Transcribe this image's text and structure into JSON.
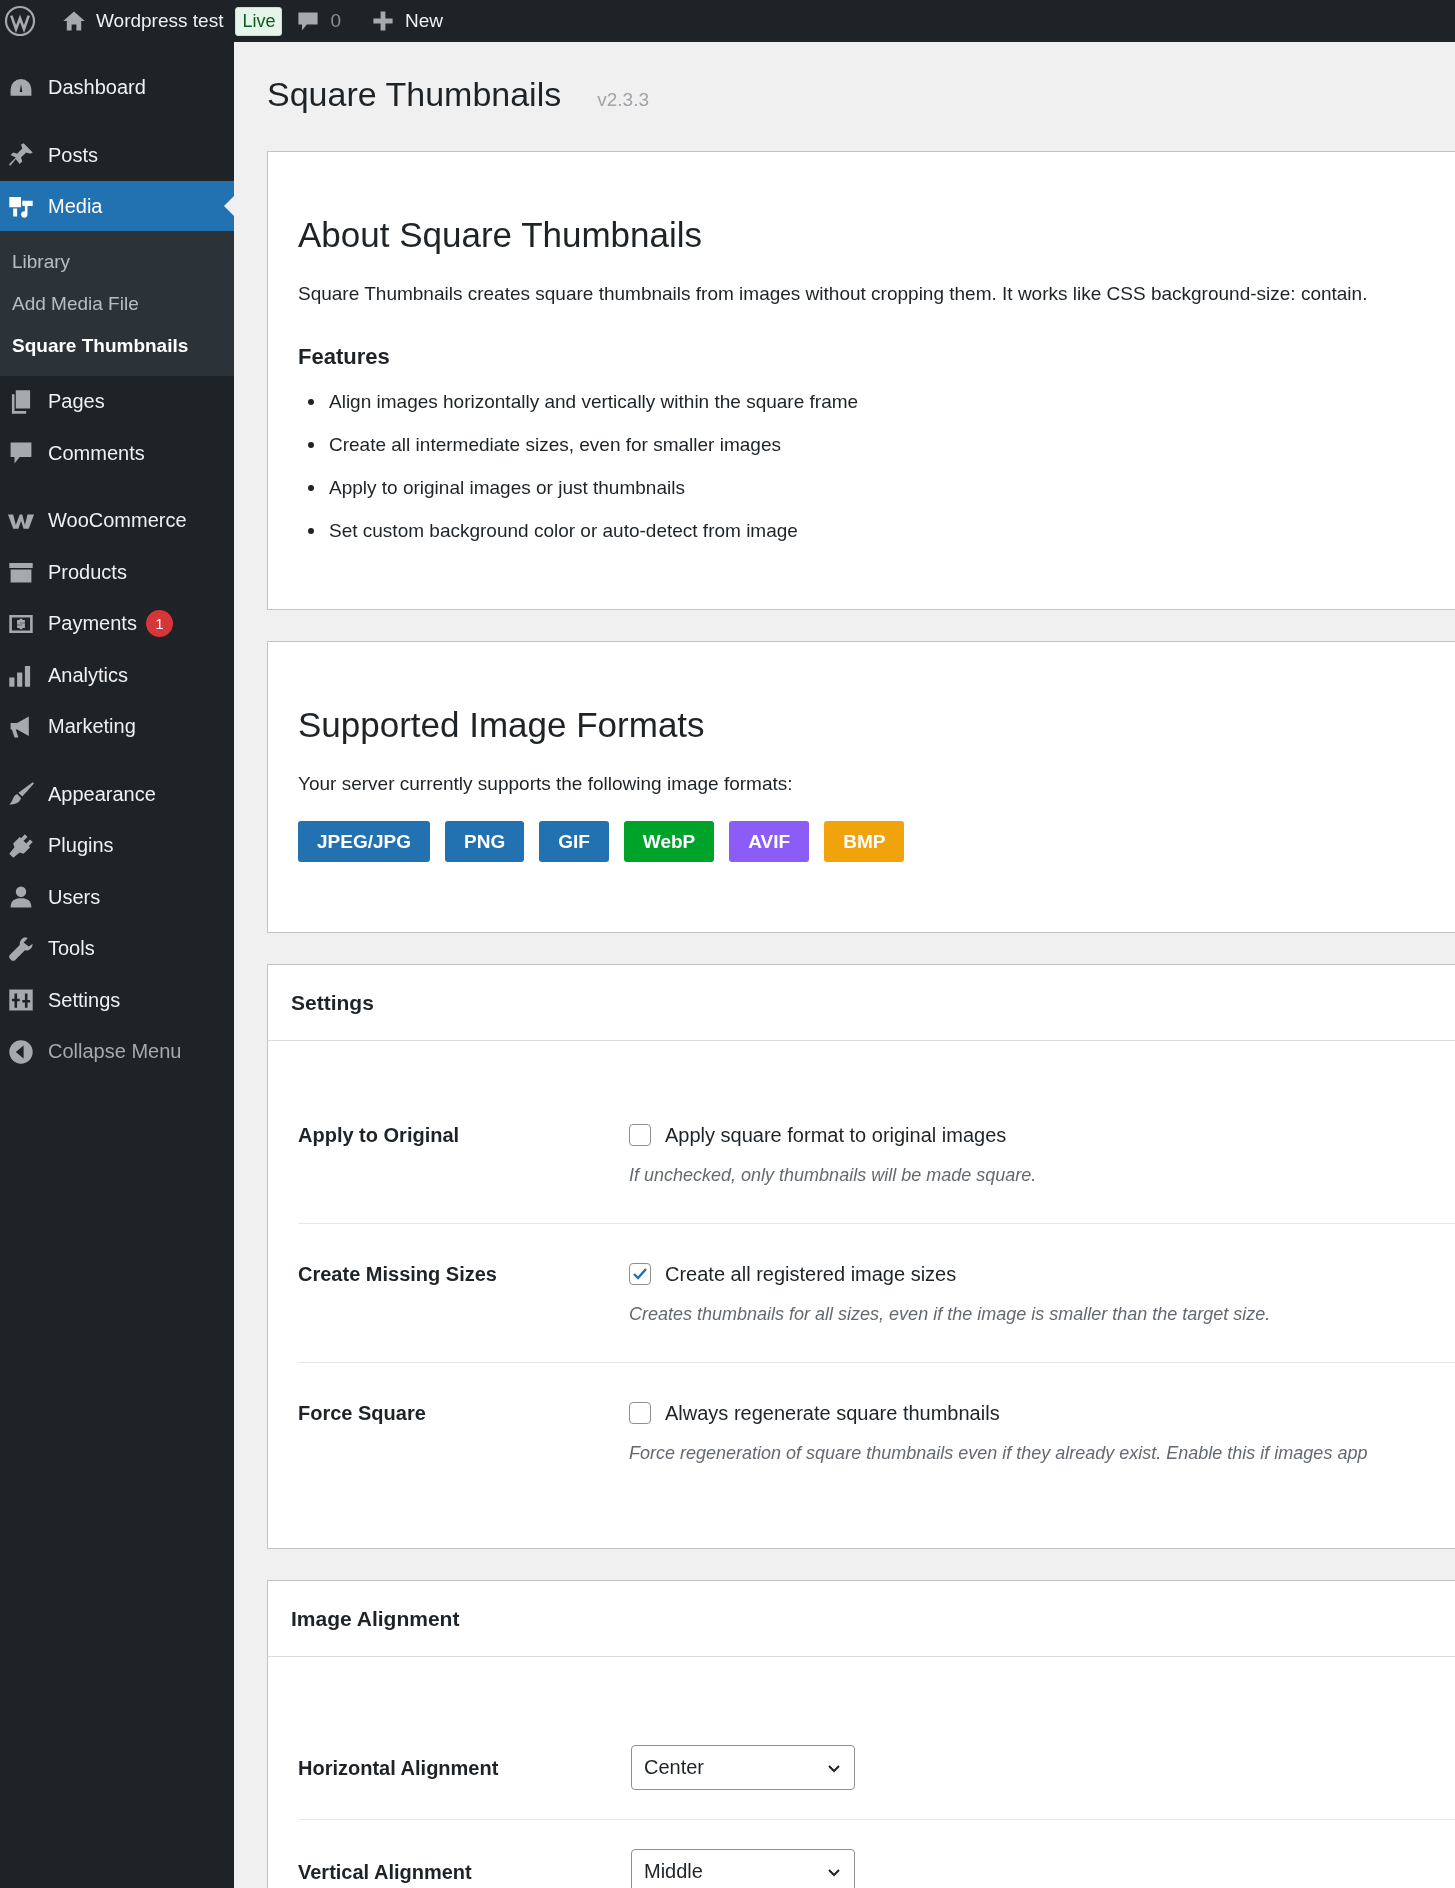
{
  "admin_bar": {
    "site_name": "Wordpress test",
    "status_badge": "Live",
    "comments_count": "0",
    "new_label": "New"
  },
  "sidebar": {
    "items": [
      {
        "label": "Dashboard",
        "selected": false
      },
      {
        "label": "Posts",
        "selected": false
      },
      {
        "label": "Media",
        "selected": true,
        "children": [
          {
            "label": "Library",
            "selected": false
          },
          {
            "label": "Add Media File",
            "selected": false
          },
          {
            "label": "Square Thumbnails",
            "selected": true
          }
        ]
      },
      {
        "label": "Pages",
        "selected": false
      },
      {
        "label": "Comments",
        "selected": false
      },
      {
        "label": "WooCommerce",
        "selected": false
      },
      {
        "label": "Products",
        "selected": false
      },
      {
        "label": "Payments",
        "selected": false,
        "badge": "1"
      },
      {
        "label": "Analytics",
        "selected": false
      },
      {
        "label": "Marketing",
        "selected": false
      },
      {
        "label": "Appearance",
        "selected": false
      },
      {
        "label": "Plugins",
        "selected": false
      },
      {
        "label": "Users",
        "selected": false
      },
      {
        "label": "Tools",
        "selected": false
      },
      {
        "label": "Settings",
        "selected": false
      }
    ],
    "collapse_label": "Collapse Menu"
  },
  "page": {
    "title": "Square Thumbnails",
    "version": "v2.3.3"
  },
  "about": {
    "title": "About Square Thumbnails",
    "description": "Square Thumbnails creates square thumbnails from images without cropping them. It works like CSS background-size: contain.",
    "features_title": "Features",
    "features": [
      "Align images horizontally and vertically within the square frame",
      "Create all intermediate sizes, even for smaller images",
      "Apply to original images or just thumbnails",
      "Set custom background color or auto-detect from image"
    ]
  },
  "formats": {
    "title": "Supported Image Formats",
    "description": "Your server currently supports the following image formats:",
    "badges": [
      {
        "label": "JPEG/JPG",
        "color": "#2271b1"
      },
      {
        "label": "PNG",
        "color": "#2271b1"
      },
      {
        "label": "GIF",
        "color": "#2271b1"
      },
      {
        "label": "WebP",
        "color": "#00a32a"
      },
      {
        "label": "AVIF",
        "color": "#8c5cf6"
      },
      {
        "label": "BMP",
        "color": "#f0a30a"
      }
    ]
  },
  "settings": {
    "title": "Settings",
    "rows": [
      {
        "label": "Apply to Original",
        "option": "Apply square format to original images",
        "checked": false,
        "description": "If unchecked, only thumbnails will be made square."
      },
      {
        "label": "Create Missing Sizes",
        "option": "Create all registered image sizes",
        "checked": true,
        "description": "Creates thumbnails for all sizes, even if the image is smaller than the target size."
      },
      {
        "label": "Force Square",
        "option": "Always regenerate square thumbnails",
        "checked": false,
        "description": "Force regeneration of square thumbnails even if they already exist. Enable this if images app"
      }
    ]
  },
  "alignment": {
    "title": "Image Alignment",
    "rows": [
      {
        "label": "Horizontal Alignment",
        "value": "Center"
      },
      {
        "label": "Vertical Alignment",
        "value": "Middle"
      }
    ]
  }
}
